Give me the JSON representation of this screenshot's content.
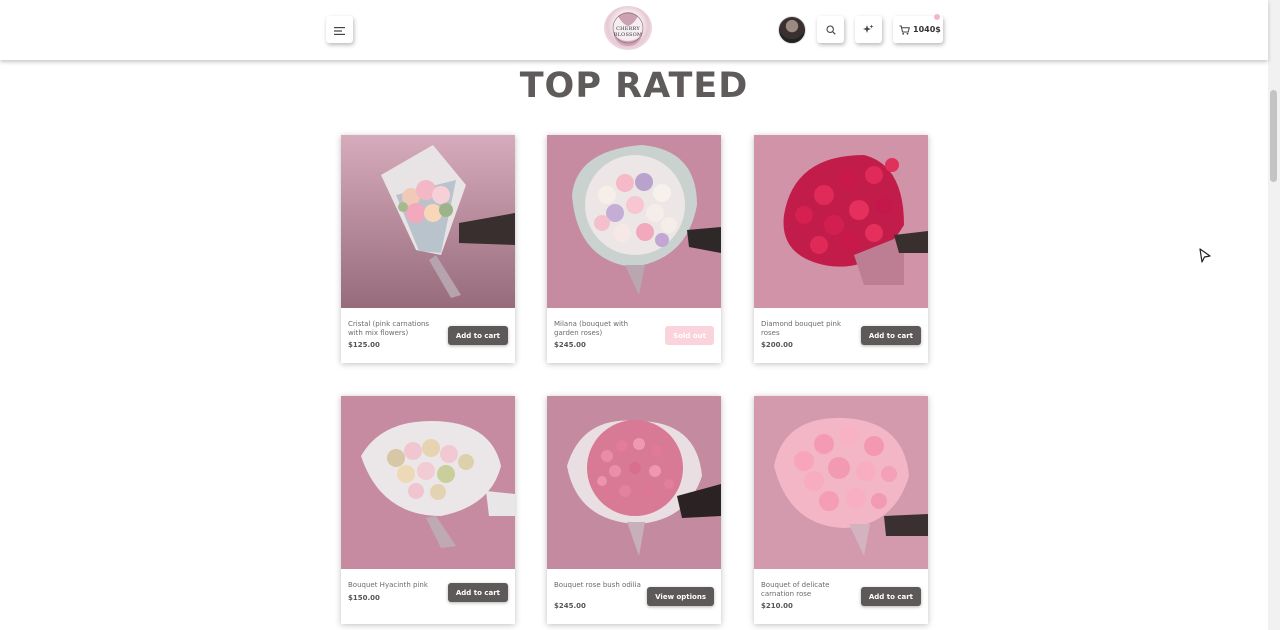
{
  "header": {
    "logo_text": "CHERRY BLOSSOM",
    "cart_total": "1040$",
    "icons": [
      "menu-icon",
      "search-icon",
      "sparkle-icon",
      "cart-icon"
    ]
  },
  "section": {
    "title": "TOP RATED"
  },
  "products": [
    {
      "name": "Cristal (pink carnations with mix flowers)",
      "price": "$125.00",
      "button": "Add to cart"
    },
    {
      "name": "Milana (bouquet with garden roses)",
      "price": "$245.00",
      "button": "Sold out"
    },
    {
      "name": "Diamond bouquet pink roses",
      "price": "$200.00",
      "button": "Add to cart"
    },
    {
      "name": "Bouquet Hyacinth pink",
      "price": "$150.00",
      "button": "Add to cart"
    },
    {
      "name": "Bouquet rose bush odilia",
      "price": "$245.00",
      "button": "View options"
    },
    {
      "name": "Bouquet of delicate carnation rose",
      "price": "$210.00",
      "button": "Add to cart"
    }
  ],
  "colors": {
    "accent_button": "#5d5959",
    "sold_out": "#fad3dc",
    "photo_bg": "#c98fa4"
  }
}
